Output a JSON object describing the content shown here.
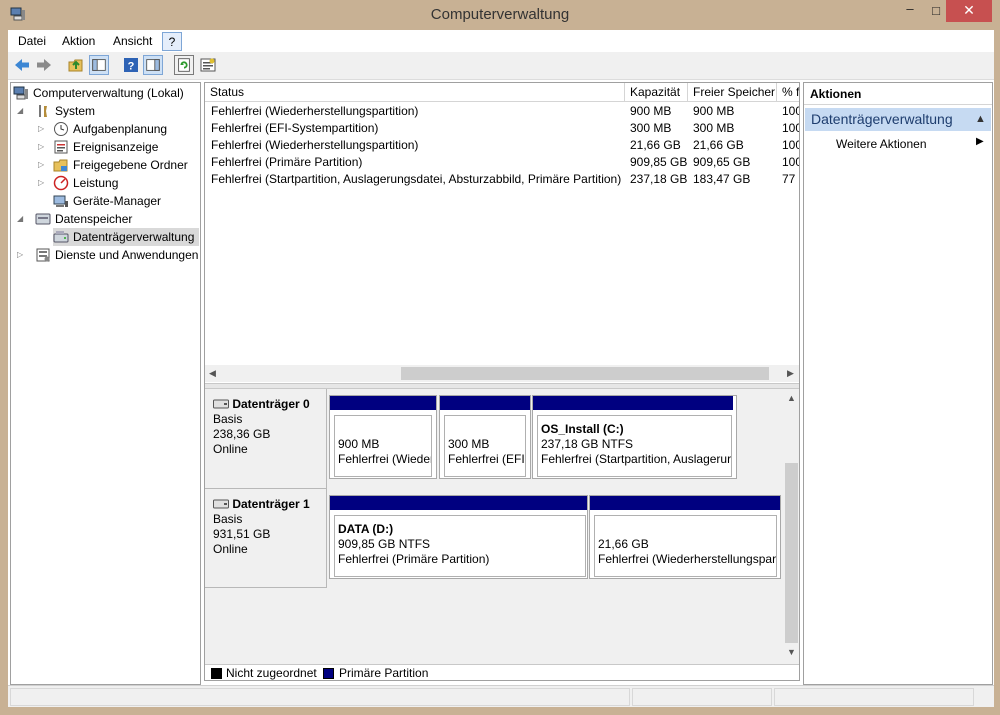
{
  "window": {
    "title": "Computerverwaltung"
  },
  "titlebar": {
    "minimize": "–",
    "maximize": "□",
    "close": "✕"
  },
  "menu": [
    "Datei",
    "Aktion",
    "Ansicht",
    "?"
  ],
  "toolbar_icons": [
    "back-arrow-icon",
    "forward-arrow-icon",
    "up-folder-icon",
    "show-hide-tree-icon",
    "help-icon",
    "show-hide-action-pane-icon",
    "refresh-icon",
    "properties-icon"
  ],
  "tree": {
    "root": "Computerverwaltung (Lokal)",
    "system": "System",
    "system_items": [
      "Aufgabenplanung",
      "Ereignisanzeige",
      "Freigegebene Ordner",
      "Leistung",
      "Geräte-Manager"
    ],
    "storage": "Datenspeicher",
    "storage_items": [
      "Datenträgerverwaltung"
    ],
    "services": "Dienste und Anwendungen"
  },
  "volumes": {
    "columns": [
      "Status",
      "Kapazität",
      "Freier Speicher",
      "% f"
    ],
    "rows": [
      {
        "status": "Fehlerfrei (Wiederherstellungspartition)",
        "capacity": "900 MB",
        "free": "900 MB",
        "pct": "100"
      },
      {
        "status": "Fehlerfrei (EFI-Systempartition)",
        "capacity": "300 MB",
        "free": "300 MB",
        "pct": "100"
      },
      {
        "status": "Fehlerfrei (Wiederherstellungspartition)",
        "capacity": "21,66 GB",
        "free": "21,66 GB",
        "pct": "100"
      },
      {
        "status": "Fehlerfrei (Primäre Partition)",
        "capacity": "909,85 GB",
        "free": "909,65 GB",
        "pct": "100"
      },
      {
        "status": "Fehlerfrei (Startpartition, Auslagerungsdatei, Absturzabbild, Primäre Partition)",
        "capacity": "237,18 GB",
        "free": "183,47 GB",
        "pct": "77 '"
      }
    ]
  },
  "disks": [
    {
      "name": "Datenträger 0",
      "type": "Basis",
      "size": "238,36 GB",
      "state": "Online",
      "partitions": [
        {
          "title": "",
          "size": "900 MB",
          "desc": "Fehlerfrei (Wieder"
        },
        {
          "title": "",
          "size": "300 MB",
          "desc": "Fehlerfrei (EFI-"
        },
        {
          "title": "OS_Install  (C:)",
          "size": "237,18 GB NTFS",
          "desc": "Fehlerfrei (Startpartition, Auslagerur"
        }
      ]
    },
    {
      "name": "Datenträger 1",
      "type": "Basis",
      "size": "931,51 GB",
      "state": "Online",
      "partitions": [
        {
          "title": "DATA  (D:)",
          "size": "909,85 GB NTFS",
          "desc": "Fehlerfrei (Primäre Partition)"
        },
        {
          "title": "",
          "size": "21,66 GB",
          "desc": "Fehlerfrei (Wiederherstellungspar"
        }
      ]
    }
  ],
  "legend": [
    {
      "label": "Nicht zugeordnet",
      "color": "#000000"
    },
    {
      "label": "Primäre Partition",
      "color": "#000080"
    }
  ],
  "actions": {
    "header": "Aktionen",
    "section": "Datenträgerverwaltung",
    "more": "Weitere Aktionen"
  },
  "colors": {
    "partition_bar": "#000080",
    "action_section": "#c6daf2",
    "close_button": "#c75050"
  }
}
